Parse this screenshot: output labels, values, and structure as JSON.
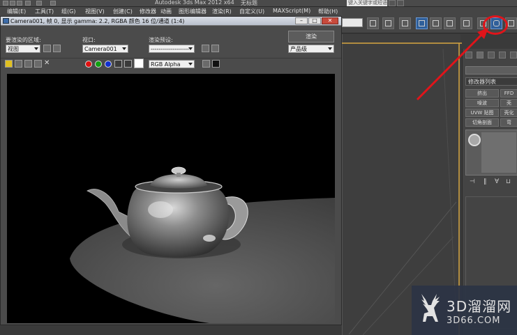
{
  "app": {
    "title": "Autodesk 3ds Max  2012 x64",
    "document_title": "无标题",
    "search_placeholder": "键入关键字或短语"
  },
  "menubar": {
    "items": [
      "编辑(E)",
      "工具(T)",
      "组(G)",
      "视图(V)",
      "创建(C)",
      "修改器",
      "动画",
      "图形编辑器",
      "渲染(R)",
      "自定义(U)",
      "MAXScript(M)",
      "帮助(H)"
    ]
  },
  "render_window": {
    "title": "Camera001, 帧 0, 显示 gamma: 2.2, RGBA 颜色 16 位/通道 (1:4)",
    "area_label": "要渲染的区域:",
    "area_value": "视图",
    "viewport_label": "视口:",
    "viewport_value": "Camera001",
    "preset_label": "渲染预设:",
    "preset_value": "-------------------",
    "render_button": "渲染",
    "quality_value": "产品级",
    "channel_value": "RGB Alpha",
    "controls": {
      "minimize": "–",
      "restore": "□",
      "close": "✕"
    },
    "channel_colors": {
      "red": "#e01010",
      "green": "#10a010",
      "blue": "#1030d0"
    }
  },
  "command_panel": {
    "modifier_list": "修改器列表",
    "buttons": [
      [
        "挤出",
        "FFD"
      ],
      [
        "噪波",
        "壳"
      ],
      [
        "UVW 贴图",
        "壳化"
      ],
      [
        "切角剖面",
        "弯"
      ]
    ]
  },
  "watermark": {
    "brand": "3D溜溜网",
    "url": "3D66.COM"
  },
  "annotation": {
    "highlight_color": "#e0141a"
  }
}
